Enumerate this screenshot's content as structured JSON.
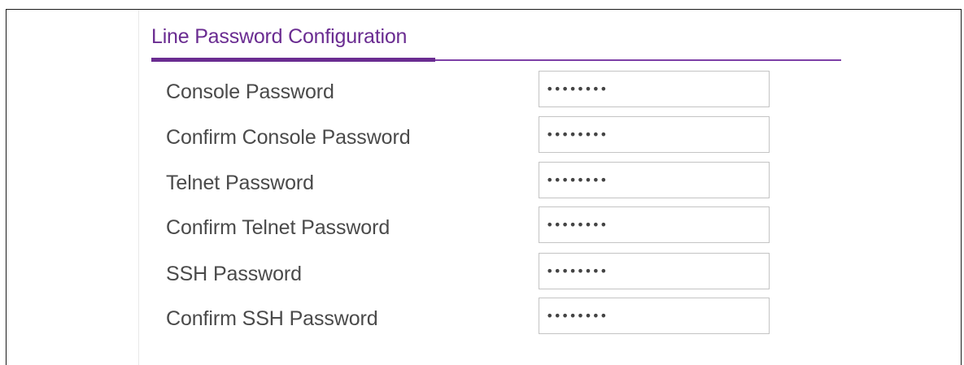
{
  "section": {
    "title": "Line Password Configuration"
  },
  "fields": [
    {
      "label": "Console Password",
      "value": "********"
    },
    {
      "label": "Confirm Console Password",
      "value": "********"
    },
    {
      "label": "Telnet Password",
      "value": "********"
    },
    {
      "label": "Confirm Telnet Password",
      "value": "********"
    },
    {
      "label": "SSH Password",
      "value": "********"
    },
    {
      "label": "Confirm SSH Password",
      "value": "********"
    }
  ],
  "colors": {
    "accent": "#6a2c91",
    "label_text": "#4a4a4a",
    "input_border": "#c4c4c4"
  }
}
